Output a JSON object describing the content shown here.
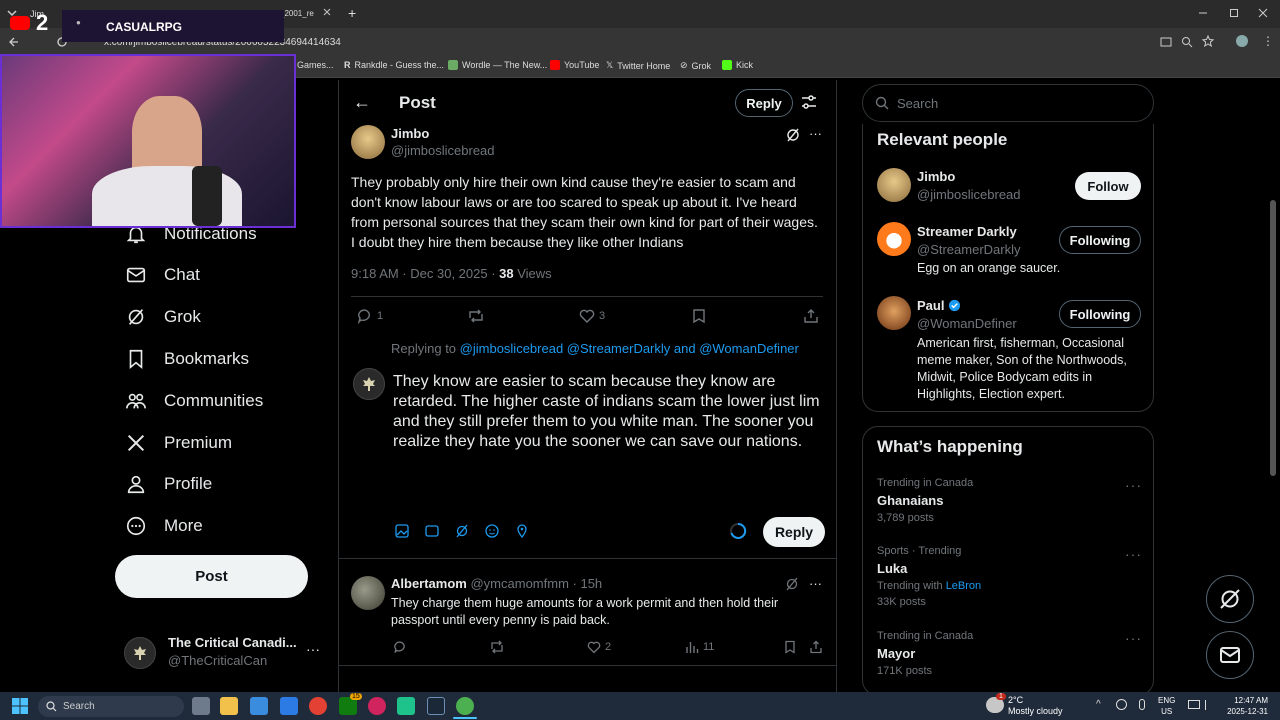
{
  "browser": {
    "address": "x.com/jimboslicebread/status/2006052234694414634",
    "tab_fragment": "_2001_re",
    "tab_short": "Jim",
    "new_tab": "+",
    "bookmarks": [
      {
        "label": "C Games...",
        "color": "#777"
      },
      {
        "label": "Rankdle - Guess the...",
        "color": "#aaa"
      },
      {
        "label": "Wordle — The New...",
        "color": "#6aaa64"
      },
      {
        "label": "YouTube",
        "color": "#ff0000"
      },
      {
        "label": "Twitter Home",
        "color": "#fff"
      },
      {
        "label": "Grok",
        "color": "#ccc"
      },
      {
        "label": "Kick",
        "color": "#53fc18"
      }
    ]
  },
  "overlay": {
    "title": "CASUALRPG",
    "count": "2"
  },
  "sidebar": {
    "items": [
      {
        "label": "Notifications",
        "icon": "bell-icon"
      },
      {
        "label": "Chat",
        "icon": "mail-icon"
      },
      {
        "label": "Grok",
        "icon": "grok-icon"
      },
      {
        "label": "Bookmarks",
        "icon": "bookmark-icon"
      },
      {
        "label": "Communities",
        "icon": "communities-icon"
      },
      {
        "label": "Premium",
        "icon": "x-logo-icon"
      },
      {
        "label": "Profile",
        "icon": "person-icon"
      },
      {
        "label": "More",
        "icon": "more-circle-icon"
      }
    ],
    "post_label": "Post",
    "account": {
      "name": "The Critical Canadi...",
      "handle": "@TheCriticalCan",
      "more": "···"
    }
  },
  "header": {
    "back": "←",
    "title": "Post",
    "reply_label": "Reply"
  },
  "tweet": {
    "name": "Jimbo",
    "handle": "@jimboslicebread",
    "text": "They probably only hire their own kind cause they're easier to scam and don't know labour laws or are too scared to speak up about it. I've heard from personal sources that they scam their own kind for part of their wages. I doubt they hire them because they like other Indians",
    "time": "9:18 AM · Dec 30, 2025 · ",
    "views_count": "38",
    "views_label": " Views",
    "replies": "1",
    "likes": "3",
    "more": "···"
  },
  "composer": {
    "replying_prefix": "Replying to ",
    "replying_to": "@jimboslicebread @StreamerDarkly",
    "and": " and ",
    "replying_last": "@WomanDefiner",
    "text": "They know are easier to scam because they know are retarded. The higher caste of indians scam the lower just lim and they still prefer them to you white man. The sooner you realize they hate you the sooner we can save our nations.",
    "reply_button": "Reply"
  },
  "reply": {
    "name": "Albertamom",
    "handle": "@ymcamomfmm",
    "time": " · 15h",
    "text": "They charge them huge amounts for a work permit and then hold their passport until every penny is paid back.",
    "likes": "2",
    "views": "11",
    "more": "···"
  },
  "search": {
    "placeholder": "Search"
  },
  "relevant": {
    "title": "Relevant people",
    "people": [
      {
        "name": "Jimbo",
        "handle": "@jimboslicebread",
        "button": "Follow",
        "bio": ""
      },
      {
        "name": "Streamer Darkly",
        "handle": "@StreamerDarkly",
        "button": "Following",
        "bio": "Egg on an orange saucer."
      },
      {
        "name": "Paul",
        "handle": "@WomanDefiner",
        "button": "Following",
        "bio": "American first, fisherman, Occasional meme maker, Son of the Northwoods, Midwit, Police Bodycam edits in Highlights, Election expert."
      }
    ]
  },
  "happening": {
    "title": "What’s happening",
    "trends": [
      {
        "context": "Trending in Canada",
        "name": "Ghanaians",
        "posts": "3,789 posts",
        "with_prefix": "",
        "with_link": ""
      },
      {
        "context": "Sports · Trending",
        "name": "Luka",
        "posts": "33K posts",
        "with_prefix": "Trending with ",
        "with_link": "LeBron"
      },
      {
        "context": "Trending in Canada",
        "name": "Mayor",
        "posts": "171K posts",
        "with_prefix": "",
        "with_link": ""
      }
    ]
  },
  "taskbar": {
    "search": "Search",
    "weather_temp": "2°C",
    "weather_desc": "Mostly cloudy",
    "lang": "ENG",
    "region": "US",
    "time": "12:47 AM",
    "date": "2025-12-31",
    "notif_count": "1",
    "badge": "15"
  }
}
